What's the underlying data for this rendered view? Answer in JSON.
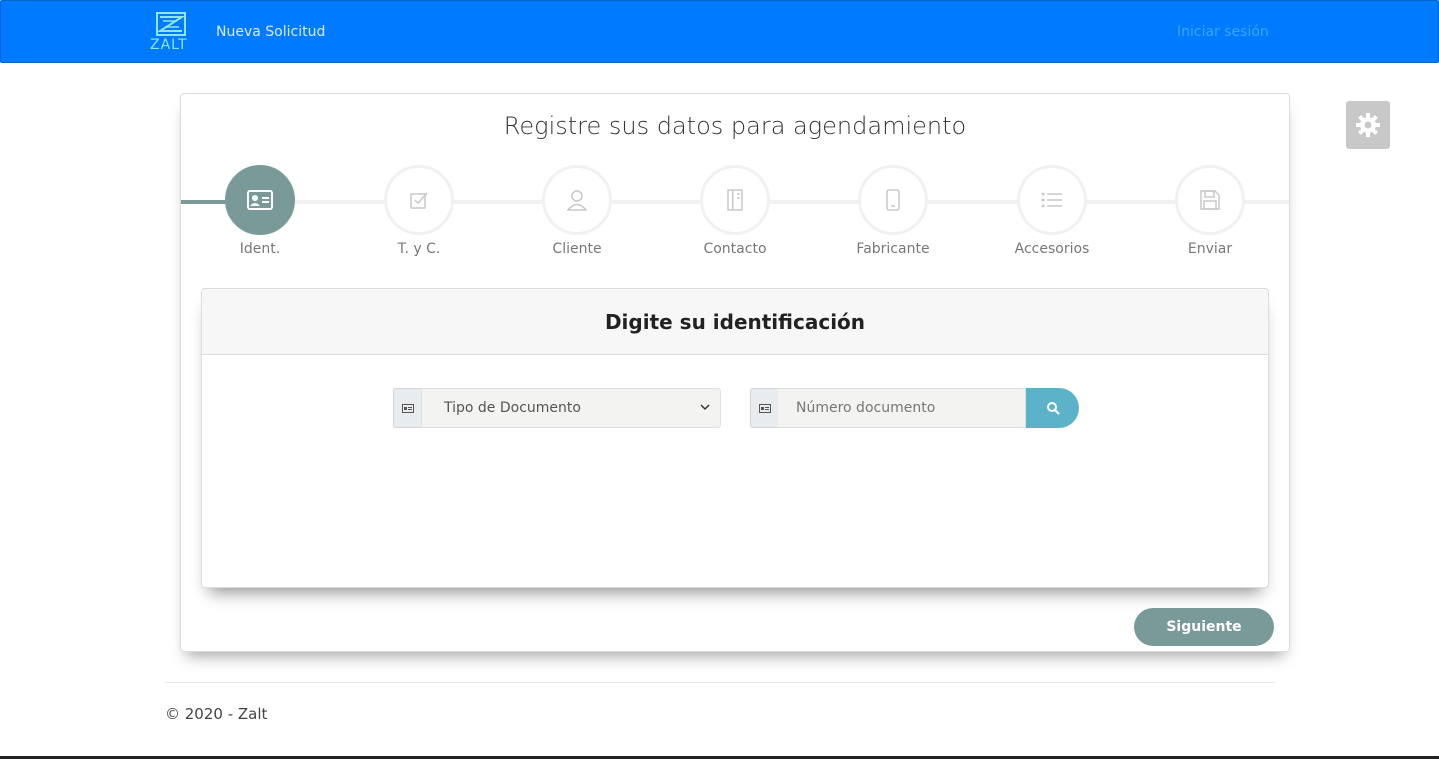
{
  "navbar": {
    "logo_text": "ZALT",
    "new_request": "Nueva Solicitud",
    "login": "Iniciar sesión",
    "color": "#007bff"
  },
  "main": {
    "title": "Registre sus datos para agendamiento",
    "steps": [
      {
        "label": "Ident.",
        "icon": "id-card-icon",
        "active": true
      },
      {
        "label": "T. y C.",
        "icon": "checkbox-icon",
        "active": false
      },
      {
        "label": "Cliente",
        "icon": "user-icon",
        "active": false
      },
      {
        "label": "Contacto",
        "icon": "address-book-icon",
        "active": false
      },
      {
        "label": "Fabricante",
        "icon": "mobile-icon",
        "active": false
      },
      {
        "label": "Accesorios",
        "icon": "list-icon",
        "active": false
      },
      {
        "label": "Enviar",
        "icon": "save-icon",
        "active": false
      }
    ],
    "panel": {
      "heading": "Digite su identificación",
      "doc_type_selected": "Tipo de Documento",
      "doc_number_placeholder": "Número documento"
    },
    "next_label": "Siguiente",
    "accent_color": "#7a9a9a"
  },
  "footer": {
    "text": "© 2020 - Zalt"
  }
}
